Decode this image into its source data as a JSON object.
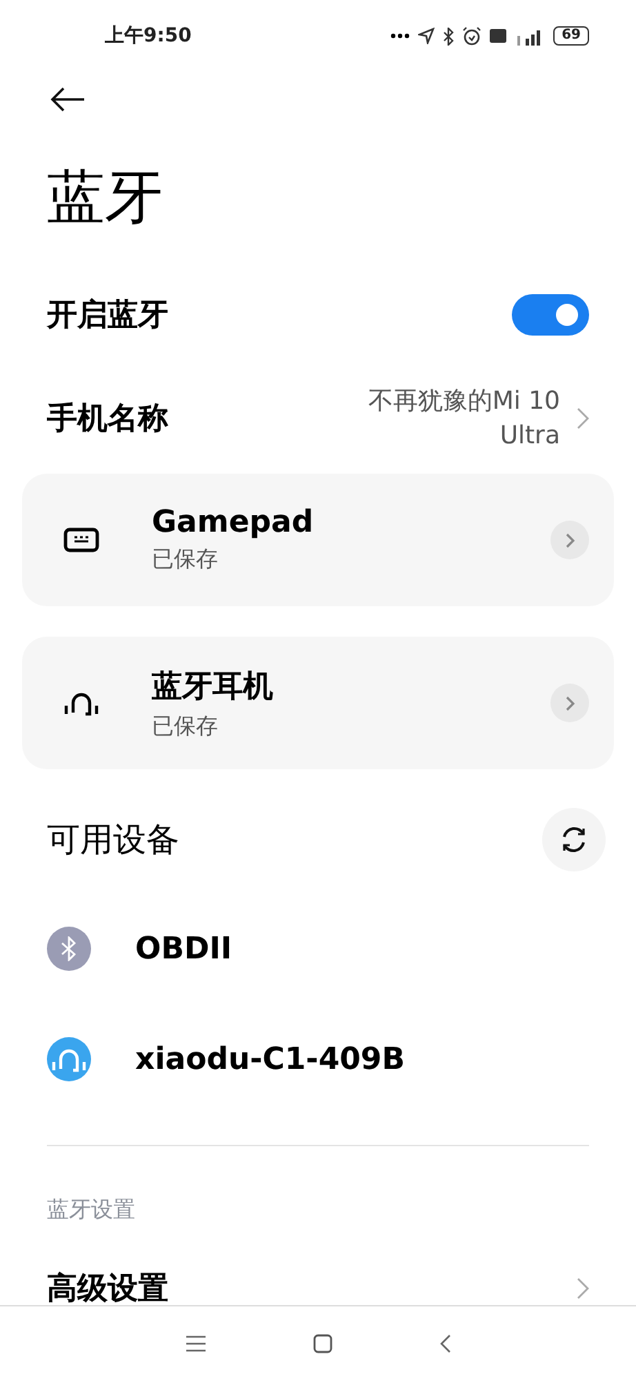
{
  "status_bar": {
    "time": "上午9:50",
    "battery": "69"
  },
  "title": "蓝牙",
  "bluetooth_toggle": {
    "label": "开启蓝牙",
    "on": true
  },
  "device_name": {
    "label": "手机名称",
    "value": "不再犹豫的Mi 10 Ultra"
  },
  "saved_devices": [
    {
      "kind": "keyboard",
      "name": "Gamepad",
      "status": "已保存"
    },
    {
      "kind": "headset",
      "name": "蓝牙耳机",
      "status": "已保存"
    }
  ],
  "available": {
    "title": "可用设备",
    "devices": [
      {
        "kind": "bluetooth",
        "name": "OBDII",
        "color": "#9a9cb4"
      },
      {
        "kind": "headset",
        "name": "xiaodu-C1-409B",
        "color": "#3aa5ee"
      }
    ]
  },
  "settings_section": {
    "title": "蓝牙设置",
    "items": [
      {
        "label": "高级设置"
      }
    ]
  }
}
